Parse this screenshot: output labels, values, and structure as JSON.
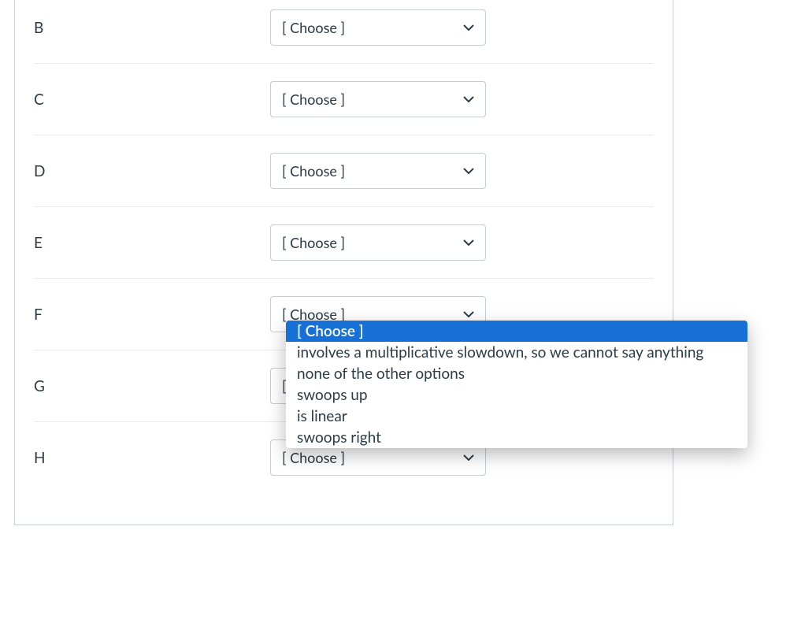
{
  "choose_placeholder": "[ Choose ]",
  "rows": [
    {
      "label": "B",
      "value": "[ Choose ]"
    },
    {
      "label": "C",
      "value": "[ Choose ]"
    },
    {
      "label": "D",
      "value": "[ Choose ]"
    },
    {
      "label": "E",
      "value": "[ Choose ]"
    },
    {
      "label": "F",
      "value": "[ Choose ]"
    },
    {
      "label": "G",
      "value": "[ Choose ]"
    },
    {
      "label": "H",
      "value": "[ Choose ]"
    }
  ],
  "dropdown": {
    "selected_index": 0,
    "options": [
      "[ Choose ]",
      "involves a multiplicative slowdown, so we cannot say anything",
      "none of the other options",
      "swoops up",
      "is linear",
      "swoops right"
    ]
  }
}
